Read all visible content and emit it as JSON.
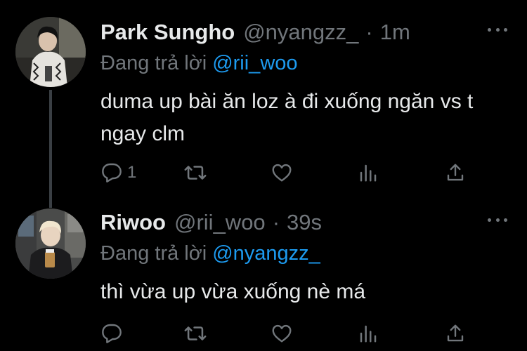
{
  "tweets": [
    {
      "display_name": "Park Sungho",
      "handle": "@nyangzz_",
      "separator": "·",
      "time": "1m",
      "replying_prefix": "Đang trả lời",
      "replying_to": "@rii_woo",
      "text": "duma up bài ăn loz à đi xuống ngăn vs t ngay clm",
      "reply_count": "1",
      "retweet_count": "",
      "like_count": ""
    },
    {
      "display_name": "Riwoo",
      "handle": "@rii_woo",
      "separator": "·",
      "time": "39s",
      "replying_prefix": "Đang trả lời",
      "replying_to": "@nyangzz_",
      "text": "thì vừa up vừa xuống nè má",
      "reply_count": "",
      "retweet_count": "",
      "like_count": ""
    }
  ],
  "colors": {
    "background": "#000000",
    "primary_text": "#e7e9ea",
    "secondary_text": "#71767b",
    "mention": "#1d9bf0",
    "thread_line": "#3a3f44"
  },
  "icons": [
    "reply-icon",
    "retweet-icon",
    "like-icon",
    "analytics-icon",
    "share-icon",
    "more-icon"
  ]
}
